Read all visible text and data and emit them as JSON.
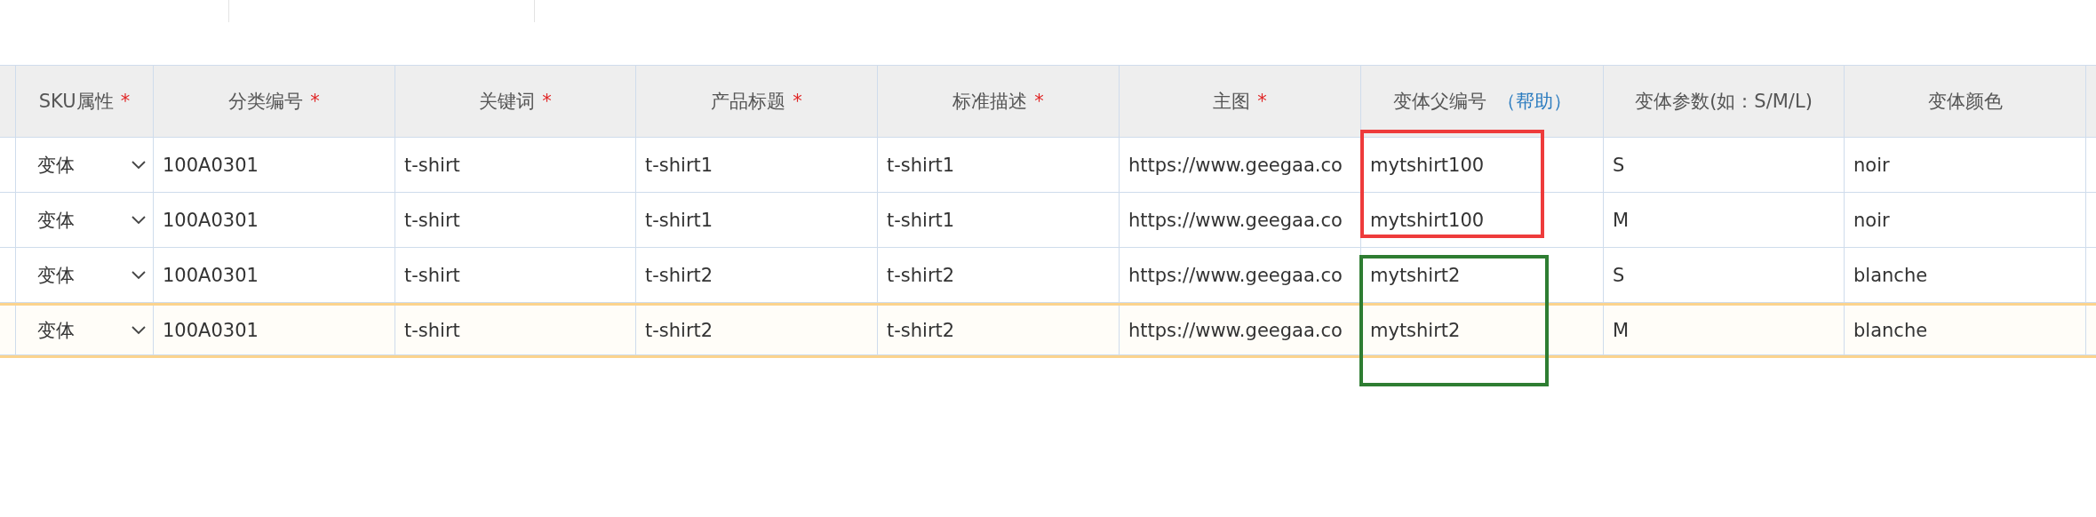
{
  "columns": [
    {
      "label": "SKU属性",
      "required_mark": "*"
    },
    {
      "label": "分类编号",
      "required_mark": "*"
    },
    {
      "label": "关键词",
      "required_mark": "*"
    },
    {
      "label": "产品标题",
      "required_mark": "*"
    },
    {
      "label": "标准描述",
      "required_mark": "*"
    },
    {
      "label": "主图",
      "required_mark": "*"
    },
    {
      "label": "变体父编号",
      "help": "（帮助）"
    },
    {
      "label": "变体参数(如：S/M/L)"
    },
    {
      "label": "变体颜色"
    }
  ],
  "rows": [
    {
      "selected": false,
      "sku": "变体",
      "cells": [
        "100A0301",
        "t-shirt",
        "t-shirt1",
        "t-shirt1",
        "https://www.geegaa.co",
        "mytshirt100",
        "S",
        "noir"
      ]
    },
    {
      "selected": false,
      "sku": "变体",
      "cells": [
        "100A0301",
        "t-shirt",
        "t-shirt1",
        "t-shirt1",
        "https://www.geegaa.co",
        "mytshirt100",
        "M",
        "noir"
      ]
    },
    {
      "selected": false,
      "sku": "变体",
      "cells": [
        "100A0301",
        "t-shirt",
        "t-shirt2",
        "t-shirt2",
        "https://www.geegaa.co",
        "mytshirt2",
        "S",
        "blanche"
      ]
    },
    {
      "selected": true,
      "sku": "变体",
      "cells": [
        "100A0301",
        "t-shirt",
        "t-shirt2",
        "t-shirt2",
        "https://www.geegaa.co",
        "mytshirt2",
        "M",
        "blanche"
      ]
    }
  ],
  "annotations": [
    {
      "color": "#ee3b3b"
    },
    {
      "color": "#2e7d32"
    }
  ]
}
